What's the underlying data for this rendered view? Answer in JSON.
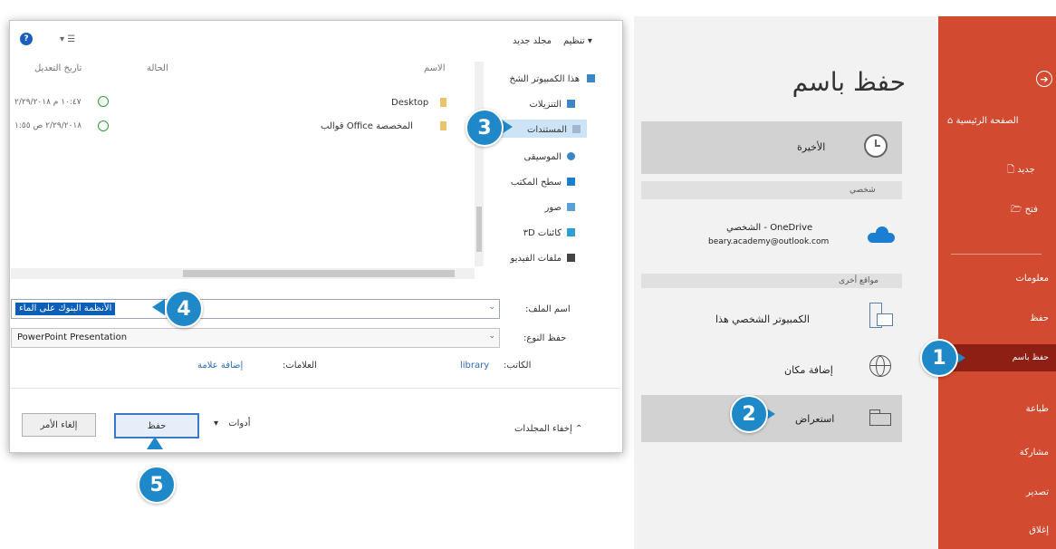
{
  "backstage": {
    "title": "حفظ باسم",
    "nav": [
      {
        "label": "الصفحة الرئيسية"
      },
      {
        "label": "جديد"
      },
      {
        "label": "فتح"
      },
      {
        "label": "معلومات"
      },
      {
        "label": "حفظ"
      },
      {
        "label": "حفظ باسم",
        "active": true
      },
      {
        "label": "طباعة"
      },
      {
        "label": "مشاركة"
      },
      {
        "label": "تصدير"
      },
      {
        "label": "إغلاق"
      }
    ],
    "recent_label": "الأخيرة",
    "personal_section": "شخصي",
    "onedrive_name": "OneDrive - الشخصي",
    "onedrive_email": "beary.academy@outlook.com",
    "other_locations_section": "مواقع أخرى",
    "this_pc_label": "الكمبيوتر الشخصي هذا",
    "add_place_label": "إضافة مكان",
    "browse_label": "استعراض"
  },
  "dialog": {
    "toolbar": {
      "organize": "تنظيم ▾",
      "new_folder": "مجلد جديد"
    },
    "tree": [
      {
        "label": "هذا الكمبيوتر الشخ",
        "icon": "pc-icon"
      },
      {
        "label": "التنزيلات",
        "icon": "download-icon"
      },
      {
        "label": "المستندات",
        "icon": "documents-icon",
        "selected": true
      },
      {
        "label": "الموسيقى",
        "icon": "music-icon"
      },
      {
        "label": "سطح المكتب",
        "icon": "desktop-icon"
      },
      {
        "label": "صور",
        "icon": "pictures-icon"
      },
      {
        "label": "كائنات ثلاثية الأبعاد",
        "display": "كائنات ٣D",
        "icon": "3d-objects-icon"
      },
      {
        "label": "ملفات الفيديو",
        "icon": "video-icon"
      }
    ],
    "columns": {
      "name": "الاسم",
      "status": "الحالة",
      "modified": "تاريخ التعديل"
    },
    "files": [
      {
        "name": "Desktop",
        "modified": "١٠:٤٧ م ٢/٢٩/٢٠١٨"
      },
      {
        "name": "قوالب Office المخصصة",
        "modified": "٢/٢٩/٢٠١٨ ص ١:٥٥"
      }
    ],
    "filename_label": "اسم الملف:",
    "filename_value": "الأنظمة البنوك على الماء",
    "filetype_label": "حفظ النوع:",
    "filetype_value": "PowerPoint Presentation",
    "authors_label": "الكاتب:",
    "authors_value": "library",
    "tags_label": "العلامات:",
    "tags_value": "إضافة علامة",
    "hide_folders": "إخفاء المجلدات",
    "tools": "أدوات",
    "save": "حفظ",
    "cancel": "إلغاء الأمر"
  },
  "callouts": [
    "1",
    "2",
    "3",
    "4",
    "5"
  ],
  "colors": {
    "accent": "#d24a2f",
    "accent_active": "#8e1f14",
    "callout": "#1e88c8",
    "selection": "#0b5fb6"
  }
}
